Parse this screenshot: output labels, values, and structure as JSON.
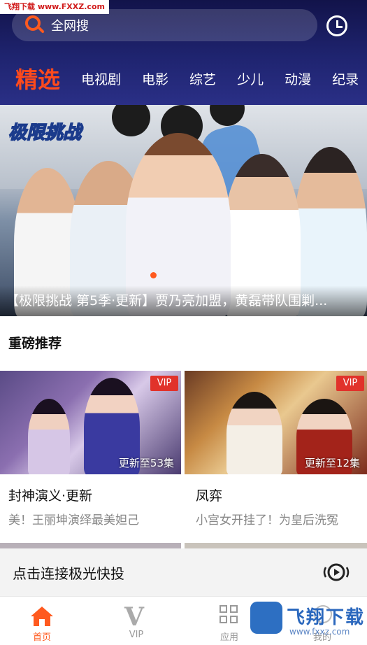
{
  "watermark": {
    "text": "飞翔下载 www.FXXZ.com"
  },
  "search": {
    "label": "全网搜"
  },
  "tabs": [
    {
      "label": "精选"
    },
    {
      "label": "电视剧"
    },
    {
      "label": "电影"
    },
    {
      "label": "综艺"
    },
    {
      "label": "少儿"
    },
    {
      "label": "动漫"
    },
    {
      "label": "纪录"
    }
  ],
  "banner": {
    "caption": "【极限挑战 第5季·更新】贾乃亮加盟，黄磊带队围剿...",
    "show_logo": "极限挑战"
  },
  "section": {
    "title": "重磅推荐"
  },
  "cards": [
    {
      "badge": "VIP",
      "episodes": "更新至53集",
      "title": "封神演义·更新",
      "subtitle": "美！王丽坤演绎最美妲己"
    },
    {
      "badge": "VIP",
      "episodes": "更新至12集",
      "title": "凤弈",
      "subtitle": "小宫女开挂了！为皇后洗冤"
    }
  ],
  "cast_bar": {
    "label": "点击连接极光快投",
    "icon": "cast-icon"
  },
  "bottom_nav": [
    {
      "label": "首页",
      "icon": "home-icon",
      "active": true
    },
    {
      "label": "VIP",
      "icon": "vip-icon",
      "active": false
    },
    {
      "label": "应用",
      "icon": "apps-icon",
      "active": false
    },
    {
      "label": "我的",
      "icon": "mine-icon",
      "active": false
    }
  ],
  "logo_watermark": {
    "text": "飞翔下载",
    "sub": "www.fxxz.com"
  },
  "colors": {
    "accent": "#ff5a1f",
    "header": "#1f2470",
    "vip": "#e1322b"
  }
}
